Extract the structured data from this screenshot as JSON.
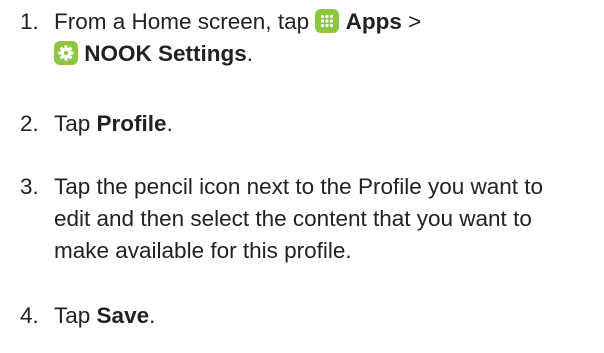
{
  "steps": [
    {
      "number": "1.",
      "t1": "From a Home screen, tap",
      "apps_label": "Apps",
      "t2": ">",
      "settings_label": "NOOK Settings",
      "t3": ".",
      "apps_icon": "apps-grid-icon",
      "settings_icon": "gear-icon"
    },
    {
      "number": "2.",
      "t1": "Tap",
      "bold": "Profile",
      "t2": "."
    },
    {
      "number": "3.",
      "text": "Tap the pencil icon next to the Profile you want to edit and then select the content that you want to make available for this profile."
    },
    {
      "number": "4.",
      "t1": "Tap",
      "bold": "Save",
      "t2": "."
    }
  ],
  "colors": {
    "text": "#222222",
    "icon_bg": "#8dc63f",
    "icon_fg": "#ffffff"
  }
}
